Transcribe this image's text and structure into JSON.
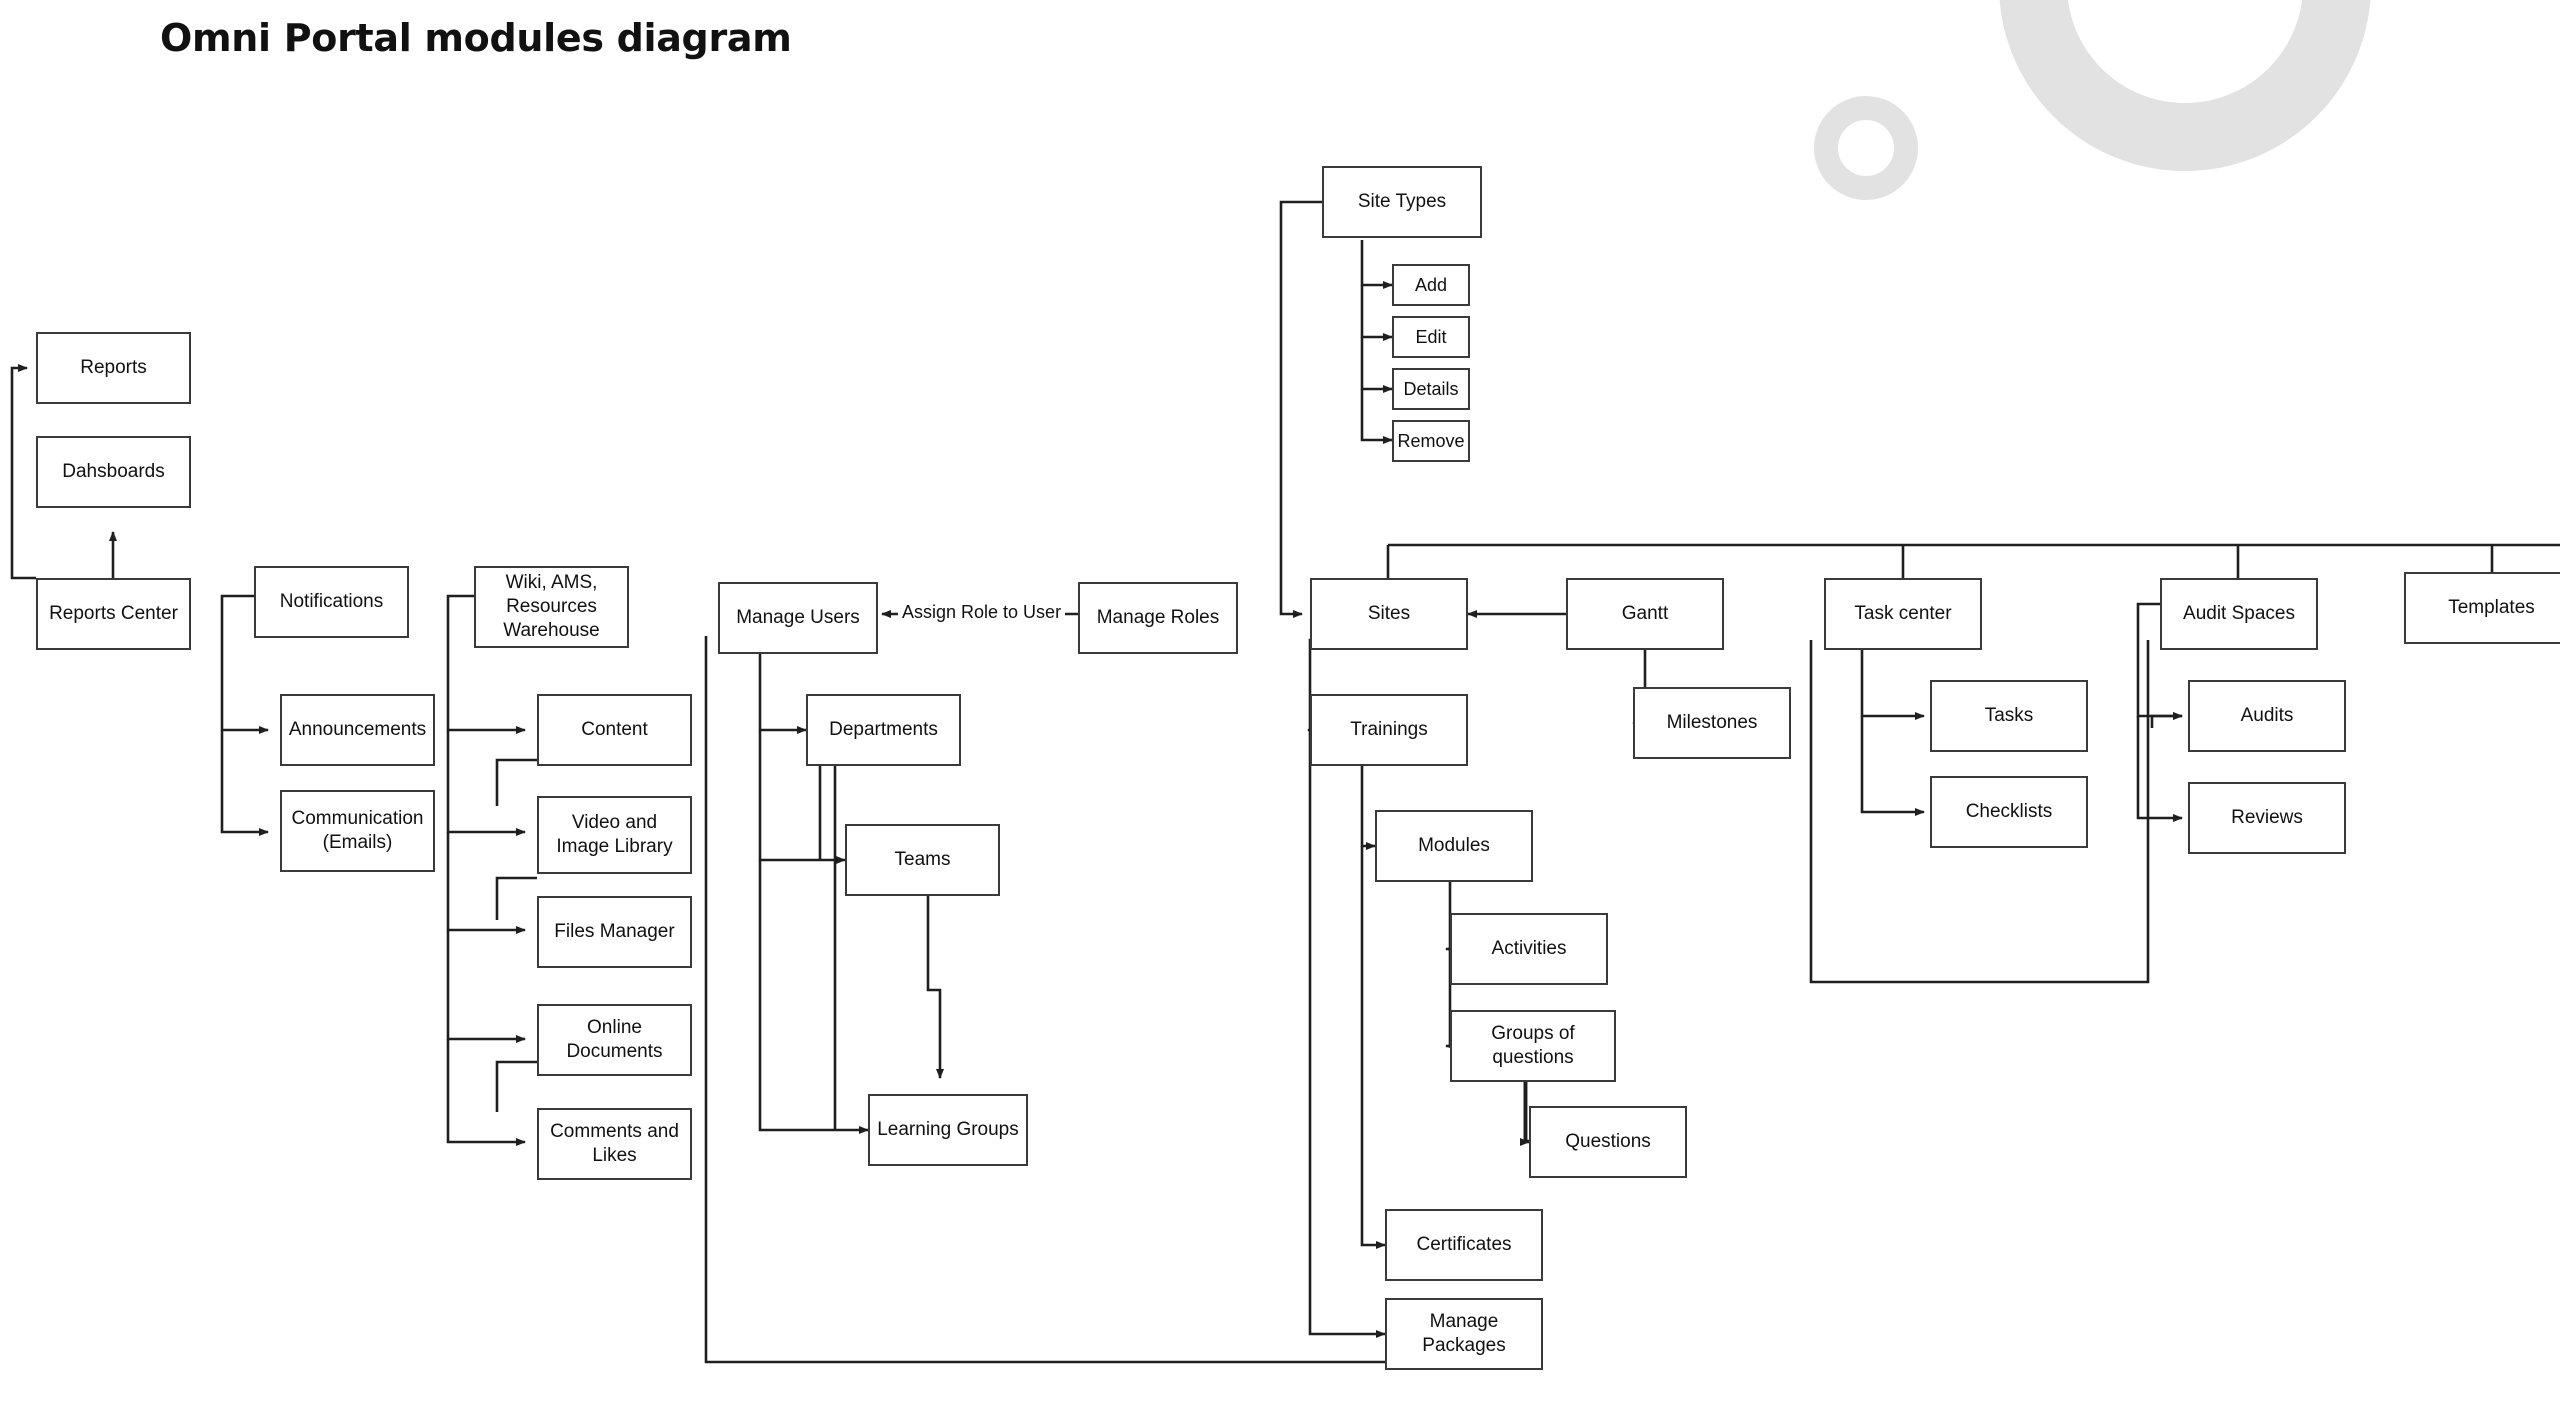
{
  "page": {
    "title": "Omni Portal modules diagram",
    "background_color": "#ffffff",
    "node_border_color": "#3a3a3a",
    "wire_color": "#1f1f1f",
    "decoration_color": "#e2e2e2"
  },
  "nodes": {
    "reports": "Reports",
    "dashboards": "Dahsboards",
    "reports_center": "Reports Center",
    "notifications": "Notifications",
    "announcements": "Announcements",
    "communication": "Communication (Emails)",
    "wiki": "Wiki, AMS, Resources Warehouse",
    "content": "Content",
    "video_image_library": "Video and Image Library",
    "files_manager": "Files Manager",
    "online_documents": "Online Documents",
    "comments_and_likes": "Comments and Likes",
    "manage_users": "Manage Users",
    "departments": "Departments",
    "teams": "Teams",
    "learning_groups": "Learning Groups",
    "manage_roles": "Manage Roles",
    "site_types": "Site Types",
    "add": "Add",
    "edit": "Edit",
    "details": "Details",
    "remove": "Remove",
    "sites": "Sites",
    "trainings": "Trainings",
    "modules": "Modules",
    "activities": "Activities",
    "groups_of_questions": "Groups of questions",
    "questions": "Questions",
    "certificates": "Certificates",
    "manage_packages": "Manage Packages",
    "gantt": "Gantt",
    "milestones": "Milestones",
    "task_center": "Task center",
    "tasks": "Tasks",
    "checklists": "Checklists",
    "audit_spaces": "Audit Spaces",
    "audits": "Audits",
    "reviews": "Reviews",
    "templates": "Templates"
  },
  "edge_labels": {
    "assign_role_to_user": "Assign Role to User"
  }
}
